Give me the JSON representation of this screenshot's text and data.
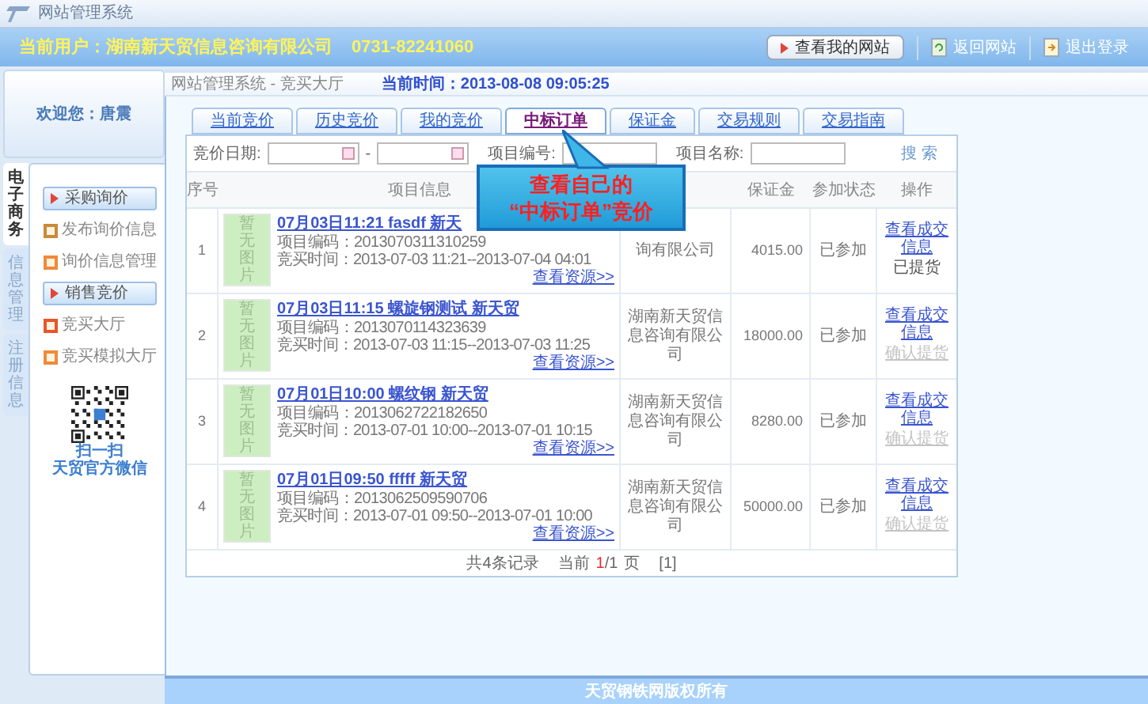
{
  "window": {
    "title": "网站管理系统"
  },
  "user_bar": {
    "user": "当前用户：湖南新天贸信息咨询有限公司",
    "phone": "0731-82241060",
    "actions": [
      {
        "kind": "button",
        "label": "查看我的网站"
      },
      {
        "kind": "link",
        "label": "返回网站"
      },
      {
        "kind": "link",
        "label": "退出登录"
      }
    ]
  },
  "sidebar": {
    "welcome": "欢迎您：唐震",
    "side_tabs": [
      {
        "label": "电子商务",
        "selected": true
      },
      {
        "label": "信息管理",
        "selected": false
      },
      {
        "label": "注册信息",
        "selected": false
      }
    ],
    "groups": [
      {
        "title": "采购询价",
        "items": [
          "发布询价信息",
          "询价信息管理"
        ]
      },
      {
        "title": "销售竞价",
        "items": [
          "竞买大厅",
          "竞买模拟大厅"
        ]
      }
    ],
    "qr_caption": [
      "扫一扫",
      "天贸官方微信"
    ]
  },
  "breadcrumb": "网站管理系统 - 竞买大厅",
  "current_time": "当前时间：2013-08-08 09:05:25",
  "tabs": [
    {
      "label": "当前竞价",
      "selected": false
    },
    {
      "label": "历史竞价",
      "selected": false
    },
    {
      "label": "我的竞价",
      "selected": false
    },
    {
      "label": "中标订单",
      "selected": true
    },
    {
      "label": "保证金",
      "selected": false
    },
    {
      "label": "交易规则",
      "selected": false
    },
    {
      "label": "交易指南",
      "selected": false
    }
  ],
  "search": {
    "date_label": "竞价日期:",
    "separator": "-",
    "code_label": "项目编号:",
    "name_label": "项目名称:",
    "button": "搜 索"
  },
  "table": {
    "columns": [
      "序号",
      "项目信息",
      "保证金",
      "参加状态",
      "操作"
    ],
    "rows": [
      {
        "index": "1",
        "image_text": "暂无图片",
        "title": "07月03日11:21 fasdf 新天",
        "code": "项目编码：2013070311310259",
        "time": "竞买时间：2013-07-03 11:21--2013-07-04 04:01",
        "more": "查看资源>>",
        "company": "询有限公司",
        "deposit": "4015.00",
        "status": "已参加",
        "view": "查看成交信息",
        "second": {
          "kind": "status",
          "label": "已提货"
        }
      },
      {
        "index": "2",
        "image_text": "暂无图片",
        "title": "07月03日11:15 螺旋钢测试 新天贸",
        "code": "项目编码：2013070114323639",
        "time": "竞买时间：2013-07-03 11:15--2013-07-03 11:25",
        "more": "查看资源>>",
        "company": "湖南新天贸信息咨询有限公司",
        "deposit": "18000.00",
        "status": "已参加",
        "view": "查看成交信息",
        "second": {
          "kind": "button",
          "label": "确认提货",
          "disabled": true
        }
      },
      {
        "index": "3",
        "image_text": "暂无图片",
        "title": "07月01日10:00 螺纹钢 新天贸",
        "code": "项目编码：2013062722182650",
        "time": "竞买时间：2013-07-01 10:00--2013-07-01 10:15",
        "more": "查看资源>>",
        "company": "湖南新天贸信息咨询有限公司",
        "deposit": "8280.00",
        "status": "已参加",
        "view": "查看成交信息",
        "second": {
          "kind": "button",
          "label": "确认提货",
          "disabled": true
        }
      },
      {
        "index": "4",
        "image_text": "暂无图片",
        "title": "07月01日09:50 fffff 新天贸",
        "code": "项目编码：2013062509590706",
        "time": "竞买时间：2013-07-01 09:50--2013-07-01 10:00",
        "more": "查看资源>>",
        "company": "湖南新天贸信息咨询有限公司",
        "deposit": "50000.00",
        "status": "已参加",
        "view": "查看成交信息",
        "second": {
          "kind": "button",
          "label": "确认提货",
          "disabled": true
        }
      }
    ]
  },
  "pagination": {
    "total": "共4条记录",
    "label": "当前",
    "current": "1",
    "pages": "/1",
    "unit": "页",
    "link": "[1]"
  },
  "callout": {
    "lines": [
      "查看自己的",
      "“中标订单”竞价"
    ]
  },
  "footer": "天贸钢铁网版权所有"
}
